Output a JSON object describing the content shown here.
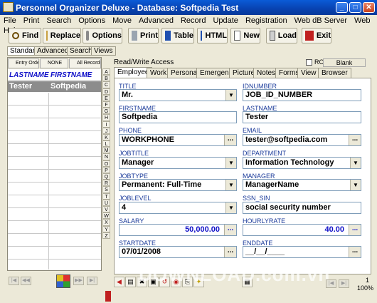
{
  "window": {
    "title": "Personnel Organizer Deluxe - Database: Softpedia Test"
  },
  "menu": [
    "File",
    "Print",
    "Search",
    "Options",
    "Move",
    "Advanced",
    "Record",
    "Update",
    "Registration",
    "Web dB Server",
    "Web",
    "Help"
  ],
  "toolbar": {
    "find": "Find",
    "replace": "Replace",
    "options": "Options",
    "print": "Print",
    "table": "Table",
    "html": "HTML",
    "new": "New",
    "load": "Load",
    "exit": "Exit"
  },
  "mode_tabs": [
    "Standard",
    "Advanced",
    "Search",
    "Views"
  ],
  "filters": {
    "entry": "Entry Order",
    "none": "NONE",
    "all": "All Records"
  },
  "list": {
    "col1": "LASTNAME",
    "col2": "FIRSTNAME",
    "rows": [
      {
        "lastname": "Tester",
        "firstname": "Softpedia"
      }
    ]
  },
  "alphabet": [
    "A",
    "B",
    "C",
    "D",
    "E",
    "F",
    "G",
    "H",
    "I",
    "J",
    "K",
    "L",
    "M",
    "N",
    "O",
    "P",
    "Q",
    "R",
    "S",
    "T",
    "U",
    "V",
    "W",
    "X",
    "Y",
    "Z"
  ],
  "access": {
    "mode": "Read/Write Access",
    "ro_label": "RO",
    "blank_label": "Blank"
  },
  "form_tabs": [
    "Employee",
    "Work",
    "Personal",
    "Emergency",
    "Picture",
    "Notes",
    "Forms",
    "View",
    "Browser"
  ],
  "fields": {
    "title": {
      "label": "TITLE",
      "value": "Mr."
    },
    "idnumber": {
      "label": "IDNUMBER",
      "value": "JOB_ID_NUMBER"
    },
    "firstname": {
      "label": "FIRSTNAME",
      "value": "Softpedia"
    },
    "lastname": {
      "label": "LASTNAME",
      "value": "Tester"
    },
    "phone": {
      "label": "PHONE",
      "value": "WORKPHONE"
    },
    "email": {
      "label": "EMAIL",
      "value": "tester@softpedia.com"
    },
    "jobtitle": {
      "label": "JOBTITLE",
      "value": "Manager"
    },
    "department": {
      "label": "DEPARTMENT",
      "value": "Information Technology"
    },
    "jobtype": {
      "label": "JOBTYPE",
      "value": "Permanent: Full-Time"
    },
    "manager": {
      "label": "MANAGER",
      "value": "ManagerName"
    },
    "joblevel": {
      "label": "JOBLEVEL",
      "value": "4"
    },
    "ssn": {
      "label": "SSN_SIN",
      "value": "social security number"
    },
    "salary": {
      "label": "SALARY",
      "value": "50,000.00"
    },
    "hourlyrate": {
      "label": "HOURLYRATE",
      "value": "40.00"
    },
    "startdate": {
      "label": "STARTDATE",
      "value": "07/01/2008"
    },
    "enddate": {
      "label": "ENDDATE",
      "value": "__/__/____"
    }
  },
  "dropdown_glyph": "▼",
  "dots_glyph": "...",
  "status": {
    "count": "1",
    "zoom": "100%"
  },
  "watermark": "DOWNLOAD.com.vn"
}
